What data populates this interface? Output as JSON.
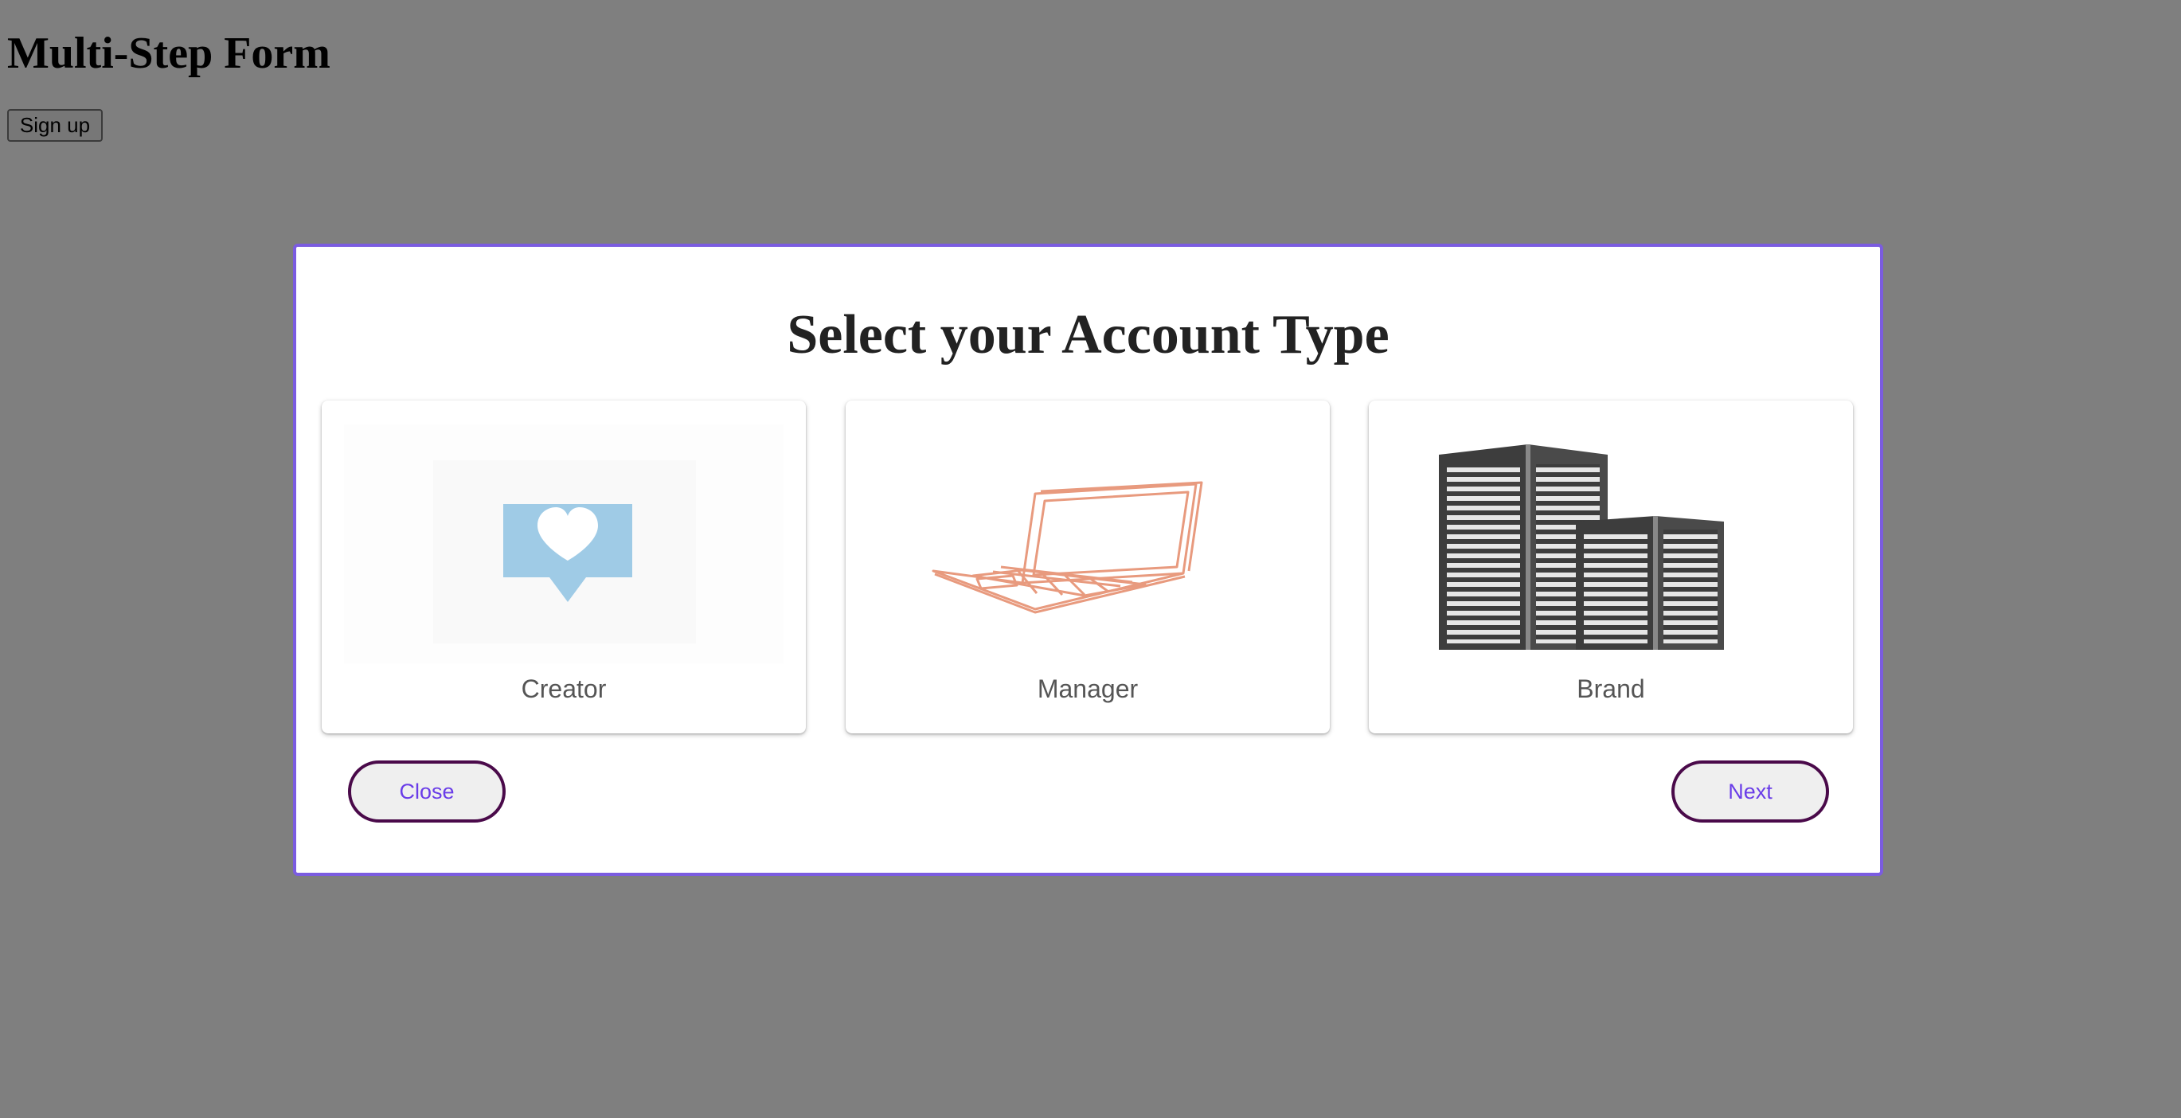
{
  "page": {
    "title": "Multi-Step Form",
    "signup_label": "Sign up"
  },
  "modal": {
    "title": "Select your Account Type",
    "cards": [
      {
        "label": "Creator",
        "icon": "heart-speech-bubble-icon"
      },
      {
        "label": "Manager",
        "icon": "laptop-icon"
      },
      {
        "label": "Brand",
        "icon": "office-buildings-icon"
      }
    ],
    "close_label": "Close",
    "next_label": "Next"
  },
  "colors": {
    "overlay": "#808080",
    "modal_border": "#7b5ce0",
    "button_text": "#6a3de8",
    "button_border": "#4a0a4a",
    "creator_icon": "#9fcbe6",
    "manager_icon": "#e89a7e",
    "brand_icon": "#3d3d3d"
  }
}
